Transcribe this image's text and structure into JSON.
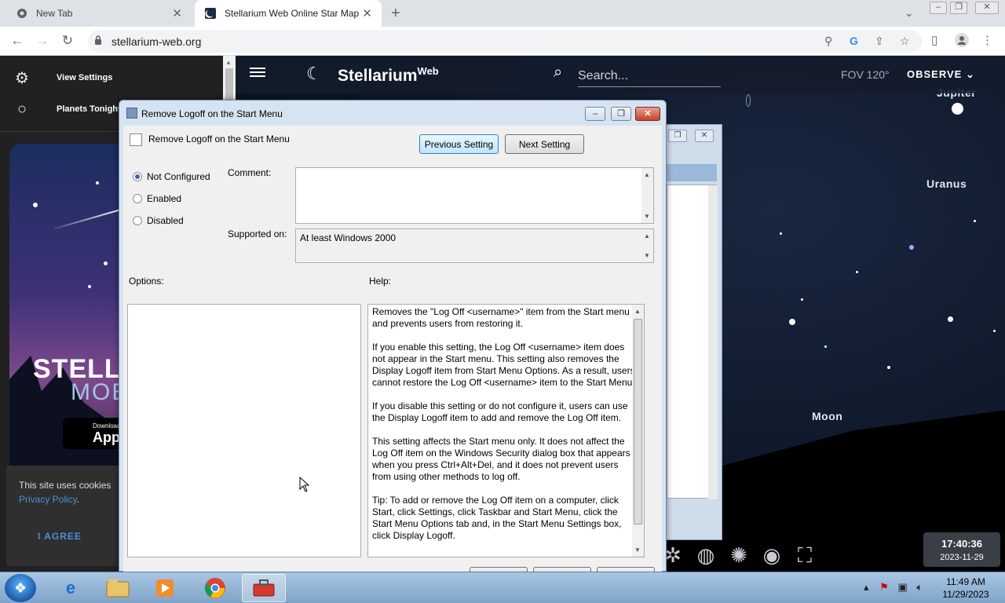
{
  "browser": {
    "tabs": [
      {
        "title": "New Tab"
      },
      {
        "title": "Stellarium Web Online Star Map"
      }
    ],
    "url": "stellarium-web.org"
  },
  "stellarium": {
    "logo": "Stellarium",
    "logo_sup": "Web",
    "search_placeholder": "Search...",
    "fov": "FOV 120°",
    "mode": "OBSERVE",
    "sidebar": [
      {
        "label": "View Settings",
        "icon": "gear-icon"
      },
      {
        "label": "Planets Tonight",
        "icon": "circle-icon"
      }
    ],
    "promo": {
      "line1": "STELLA",
      "line2": "MOB",
      "store_small": "Download",
      "store_large": "App"
    },
    "cookie": {
      "text": "This site uses cookies",
      "link": "Privacy Policy",
      "agree": "I AGREE"
    },
    "labels": {
      "jupiter": "Jupiter",
      "uranus": "Uranus",
      "moon": "Moon"
    },
    "clock": {
      "time": "17:40:36",
      "date": "2023-11-29"
    }
  },
  "dialog": {
    "title": "Remove Logoff on the Start Menu",
    "setting_name": "Remove Logoff on the Start Menu",
    "prev_button": "Previous Setting",
    "next_button": "Next Setting",
    "radios": [
      {
        "label": "Not Configured",
        "checked": true
      },
      {
        "label": "Enabled",
        "checked": false
      },
      {
        "label": "Disabled",
        "checked": false
      }
    ],
    "comment_label": "Comment:",
    "comment_value": "",
    "supported_label": "Supported on:",
    "supported_value": "At least Windows 2000",
    "options_label": "Options:",
    "help_label": "Help:",
    "help": [
      "Removes the \"Log Off <username>\" item from the Start menu and prevents users from restoring it.",
      "If you enable this setting, the Log Off <username> item does not appear in the Start menu. This setting also removes the Display Logoff item from Start Menu Options. As a result, users cannot restore the Log Off <username> item to the Start Menu.",
      "If you disable this setting or do not configure it, users can use the Display Logoff item to add and remove the Log Off item.",
      "This setting affects the Start menu only. It does not affect the Log Off item on the Windows Security dialog box that appears when you press Ctrl+Alt+Del, and it does not prevent users from using other methods to log off.",
      "Tip: To add or remove the Log Off item on a computer, click Start, click Settings, click Taskbar and Start Menu, click the Start Menu Options tab and, in the Start Menu Settings box, click Display Logoff."
    ]
  },
  "taskbar": {
    "apps": [
      "internet-explorer-icon",
      "file-explorer-icon",
      "media-player-icon",
      "chrome-icon",
      "toolbox-icon"
    ],
    "time": "11:49 AM",
    "date": "11/29/2023"
  }
}
